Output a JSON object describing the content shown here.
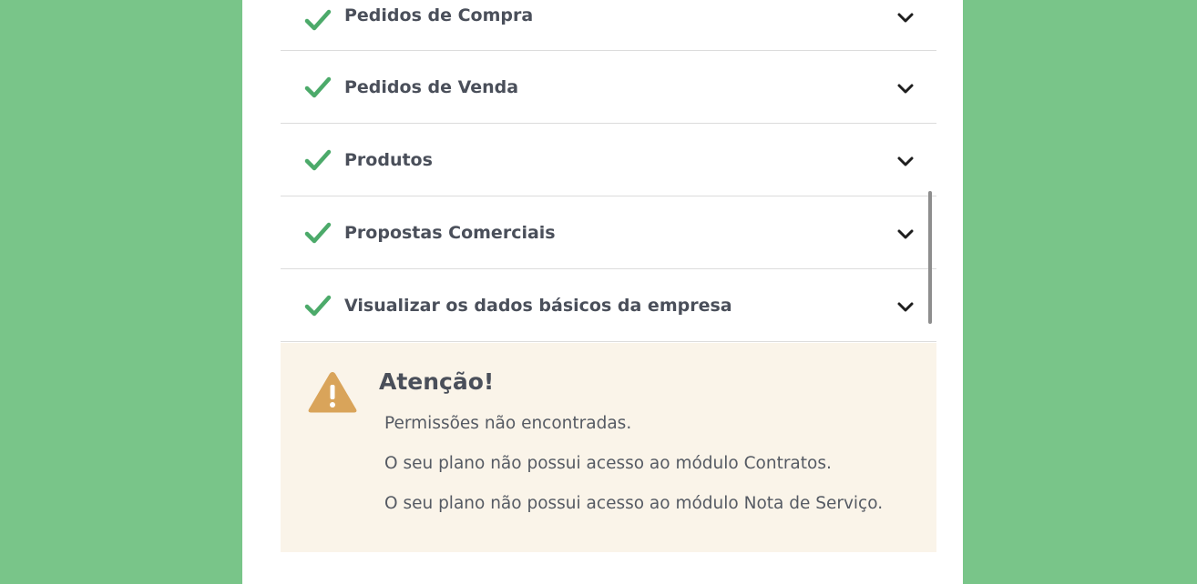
{
  "permissions": [
    {
      "label": "Pedidos de Compra",
      "icon": "check-icon"
    },
    {
      "label": "Pedidos de Venda",
      "icon": "check-icon"
    },
    {
      "label": "Produtos",
      "icon": "check-icon"
    },
    {
      "label": "Propostas Comerciais",
      "icon": "check-icon"
    },
    {
      "label": "Visualizar os dados básicos da empresa",
      "icon": "check-icon"
    }
  ],
  "alert": {
    "icon": "warning-icon",
    "title": "Atenção!",
    "messages": [
      "Permissões não encontradas.",
      "O seu plano não possui acesso ao módulo Contratos.",
      "O seu plano não possui acesso ao módulo Nota de Serviço."
    ]
  },
  "colors": {
    "background": "#79c589",
    "check": "#4caa6a",
    "alert_bg": "#faf4e9",
    "warning": "#d9a45a"
  }
}
